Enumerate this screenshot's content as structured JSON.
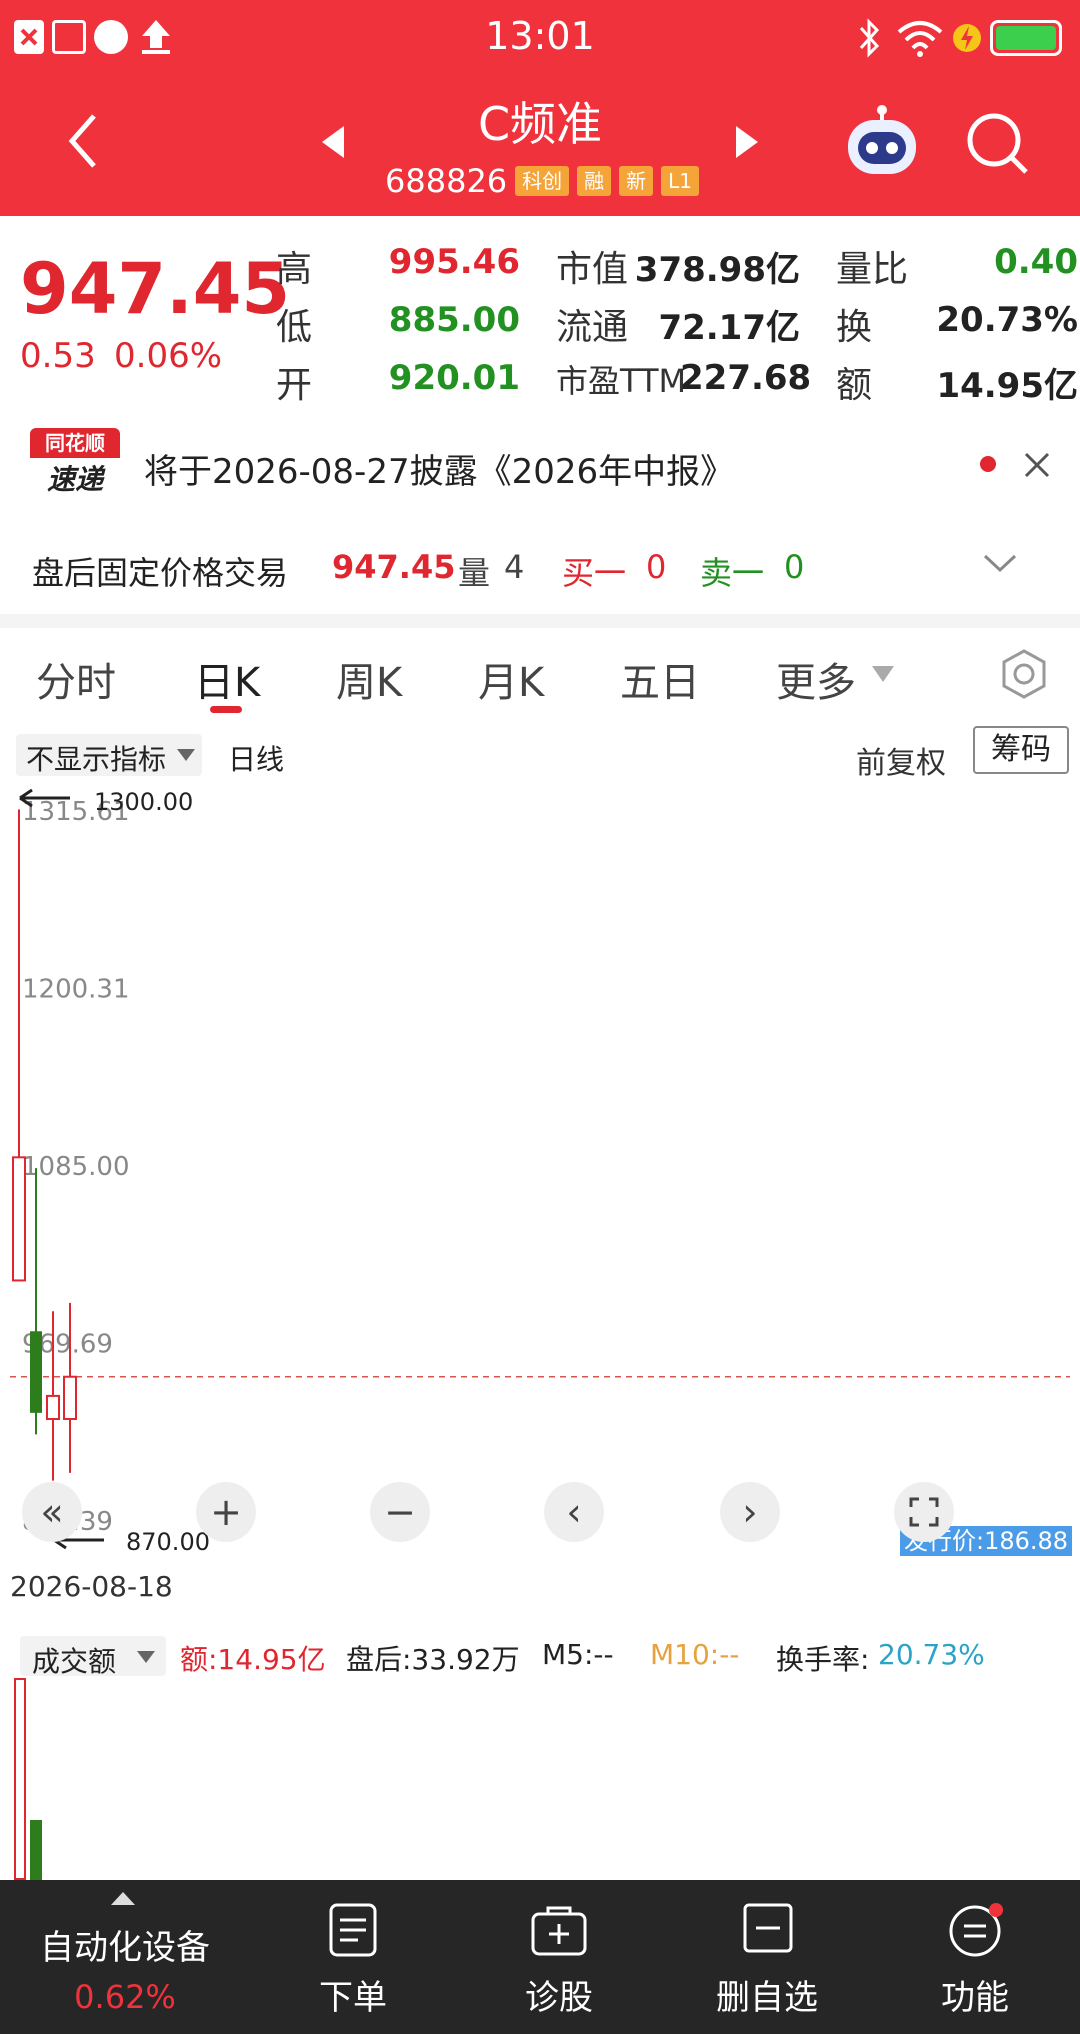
{
  "status_bar": {
    "time": "13:01"
  },
  "header": {
    "title": "C频准",
    "code": "688826",
    "tags": [
      "科创",
      "融",
      "新",
      "L1"
    ]
  },
  "quote": {
    "price": "947.45",
    "change": "0.53",
    "change_pct": "0.06%",
    "high_label": "高",
    "high": "995.46",
    "low_label": "低",
    "low": "885.00",
    "open_label": "开",
    "open": "920.01",
    "mktcap_label": "市值",
    "mktcap": "378.98亿",
    "float_label": "流通",
    "float": "72.17亿",
    "pe_label": "市盈TTM",
    "pe": "227.68",
    "volratio_label": "量比",
    "volratio": "0.40",
    "turnover_label": "换",
    "turnover": "20.73%",
    "amount_label": "额",
    "amount": "14.95亿"
  },
  "notice": {
    "logo_top": "同花顺",
    "logo_bottom": "速递",
    "text": "将于2026-08-27披露《2026年中报》"
  },
  "after_hours": {
    "label": "盘后固定价格交易",
    "price": "947.45",
    "vol_label": "量",
    "vol": "4",
    "buy_label": "买一",
    "buy": "0",
    "sell_label": "卖一",
    "sell": "0"
  },
  "tabs": [
    "分时",
    "日K",
    "周K",
    "月K",
    "五日",
    "更多"
  ],
  "chart_toolbar": {
    "indicator": "不显示指标",
    "line_type": "日线",
    "adjust": "前复权",
    "chip": "筹码"
  },
  "chart_data": {
    "type": "candlestick",
    "y_ticks": [
      "1315.61",
      "1200.31",
      "1085.00",
      "969.69",
      "854.39"
    ],
    "max_label": "1300.00",
    "min_label": "870.00",
    "issue_price": "发行价:186.88",
    "date": "2026-08-18",
    "current_price_line": 947.45,
    "candles": [
      {
        "open": 1010,
        "close": 1090,
        "high": 1316,
        "low": 1080,
        "color": "red"
      },
      {
        "open": 977,
        "close": 924,
        "high": 1083,
        "low": 910,
        "color": "green"
      },
      {
        "open": 920,
        "close": 935,
        "high": 990,
        "low": 880,
        "color": "red"
      },
      {
        "open": 920,
        "close": 947.45,
        "high": 995.46,
        "low": 885,
        "color": "red"
      }
    ]
  },
  "volume_bar": {
    "selector": "成交额",
    "amount": "额:14.95亿",
    "after": "盘后:33.92万",
    "m5": "M5:--",
    "m10": "M10:--",
    "turnover_label": "换手率:",
    "turnover": "20.73%"
  },
  "bottom_bar": {
    "sector": "自动化设备",
    "sector_pct": "0.62%",
    "items": [
      "下单",
      "诊股",
      "删自选",
      "功能"
    ]
  }
}
